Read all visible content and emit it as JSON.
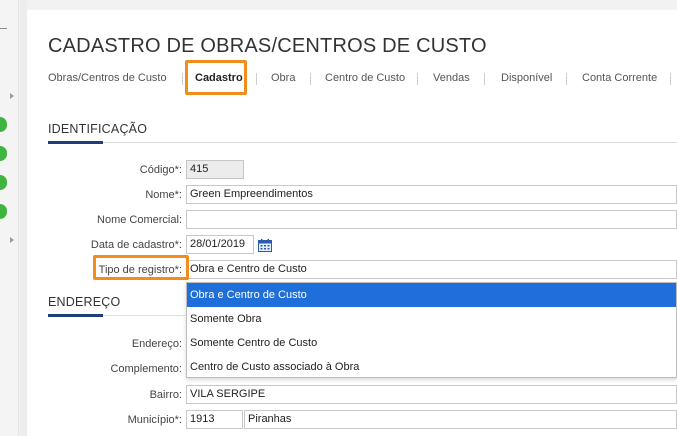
{
  "page": {
    "title": "CADASTRO DE OBRAS/CENTROS DE CUSTO"
  },
  "tabs": [
    {
      "label": "Obras/Centros de Custo",
      "active": false
    },
    {
      "label": "Cadastro",
      "active": true
    },
    {
      "label": "Obra",
      "active": false
    },
    {
      "label": "Centro de Custo",
      "active": false
    },
    {
      "label": "Vendas",
      "active": false
    },
    {
      "label": "Disponível",
      "active": false
    },
    {
      "label": "Conta Corrente",
      "active": false
    }
  ],
  "sections": {
    "identificacao": "IDENTIFICAÇÃO",
    "endereco": "ENDEREÇO"
  },
  "fields": {
    "codigo": {
      "label": "Código*:",
      "value": "415"
    },
    "nome": {
      "label": "Nome*:",
      "value": "Green Empreendimentos"
    },
    "nome_comercial": {
      "label": "Nome Comercial:",
      "value": ""
    },
    "data_cadastro": {
      "label": "Data de cadastro*:",
      "value": "28/01/2019"
    },
    "tipo_registro": {
      "label": "Tipo de registro*:",
      "value": "Obra e Centro de Custo"
    },
    "endereco": {
      "label": "Endereço:",
      "value": ""
    },
    "complemento": {
      "label": "Complemento:",
      "value": ""
    },
    "bairro": {
      "label": "Bairro:",
      "value": "VILA SERGIPE"
    },
    "municipio": {
      "label": "Município*:",
      "code": "1913",
      "value": "Piranhas"
    }
  },
  "dropdown": {
    "options": [
      "Obra e Centro de Custo",
      "Somente Obra",
      "Somente Centro de Custo",
      "Centro de Custo associado à Obra"
    ],
    "selected_index": 0
  },
  "colors": {
    "highlight": "#f28c1c",
    "selected_option": "#1e6fd9",
    "section_accent": "#1f3f7a",
    "status_green": "#3fb53f"
  },
  "icons": {
    "calendar": "calendar-icon",
    "rail_arrow": "chevron-right-icon",
    "rail_status": "status-dot-icon"
  }
}
